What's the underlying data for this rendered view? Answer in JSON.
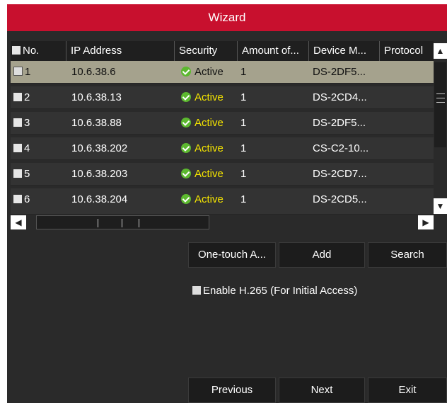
{
  "window": {
    "title": "Wizard"
  },
  "table": {
    "columns": [
      "No.",
      "IP Address",
      "Security",
      "Amount of...",
      "Device M...",
      "Protocol"
    ],
    "rows": [
      {
        "no": "1",
        "ip": "10.6.38.6",
        "security": "Active",
        "amount": "1",
        "model": "DS-2DF5...",
        "protocol": ""
      },
      {
        "no": "2",
        "ip": "10.6.38.13",
        "security": "Active",
        "amount": "1",
        "model": "DS-2CD4...",
        "protocol": ""
      },
      {
        "no": "3",
        "ip": "10.6.38.88",
        "security": "Active",
        "amount": "1",
        "model": "DS-2DF5...",
        "protocol": ""
      },
      {
        "no": "4",
        "ip": "10.6.38.202",
        "security": "Active",
        "amount": "1",
        "model": "CS-C2-10...",
        "protocol": ""
      },
      {
        "no": "5",
        "ip": "10.6.38.203",
        "security": "Active",
        "amount": "1",
        "model": "DS-2CD7...",
        "protocol": ""
      },
      {
        "no": "6",
        "ip": "10.6.38.204",
        "security": "Active",
        "amount": "1",
        "model": "DS-2CD5...",
        "protocol": ""
      }
    ],
    "selected_row": "1"
  },
  "actions": {
    "one_touch": "One-touch A...",
    "add": "Add",
    "search": "Search"
  },
  "options": {
    "enable_h265": "Enable H.265 (For Initial Access)"
  },
  "footer": {
    "previous": "Previous",
    "next": "Next",
    "exit": "Exit"
  },
  "icons": {
    "active": "check-circle-icon",
    "scroll_up": "chevron-up-icon",
    "scroll_down": "chevron-down-icon",
    "scroll_left": "chevron-left-icon",
    "scroll_right": "chevron-right-icon"
  },
  "colors": {
    "title_bar": "#c8102e",
    "active_text": "#f5e500",
    "selected_row": "#a5a28d",
    "active_icon": "#5cb82f"
  }
}
